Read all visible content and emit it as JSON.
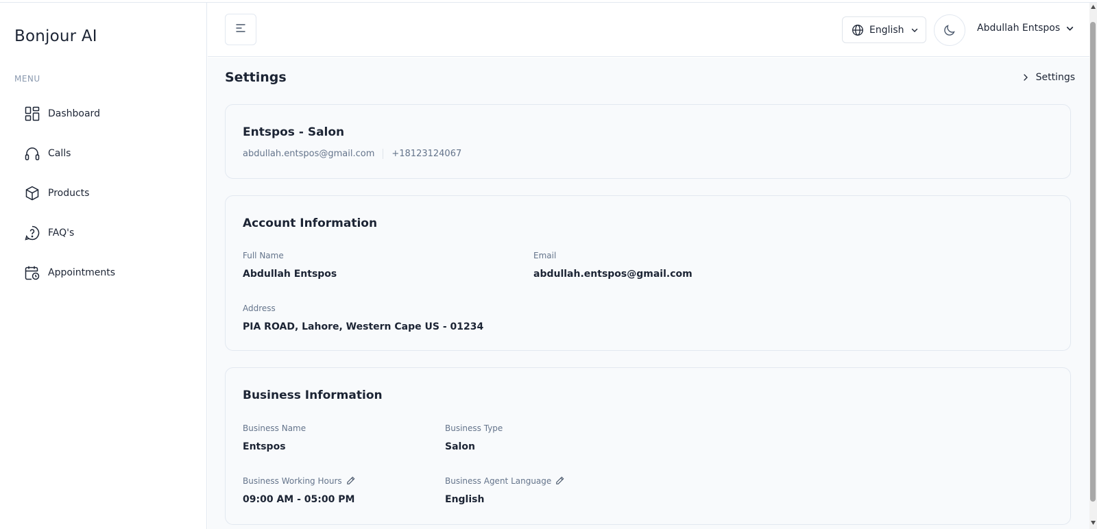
{
  "sidebar": {
    "brand": "Bonjour AI",
    "menu_label": "MENU",
    "items": [
      {
        "label": "Dashboard",
        "icon": "dashboard-grid-icon"
      },
      {
        "label": "Calls",
        "icon": "headset-icon"
      },
      {
        "label": "Products",
        "icon": "box-icon"
      },
      {
        "label": "FAQ's",
        "icon": "question-circle-icon"
      },
      {
        "label": "Appointments",
        "icon": "calendar-clock-icon"
      }
    ]
  },
  "header": {
    "language": "English",
    "user_name": "Abdullah Entspos"
  },
  "page": {
    "title": "Settings",
    "breadcrumb": "Settings"
  },
  "profile": {
    "title": "Entspos - Salon",
    "email": "abdullah.entspos@gmail.com",
    "phone": "+18123124067"
  },
  "account": {
    "heading": "Account Information",
    "full_name_label": "Full Name",
    "full_name": "Abdullah Entspos",
    "email_label": "Email",
    "email": "abdullah.entspos@gmail.com",
    "address_label": "Address",
    "address": "PIA ROAD, Lahore, Western Cape US - 01234"
  },
  "business": {
    "heading": "Business Information",
    "name_label": "Business Name",
    "name": "Entspos",
    "type_label": "Business Type",
    "type": "Salon",
    "hours_label": "Business Working Hours",
    "hours": "09:00 AM - 05:00 PM",
    "agent_lang_label": "Business Agent Language",
    "agent_lang": "English"
  },
  "colors": {
    "text": "#1c2434",
    "muted": "#64748b",
    "border": "#e2e8f0",
    "surface": "#f8fafc"
  }
}
